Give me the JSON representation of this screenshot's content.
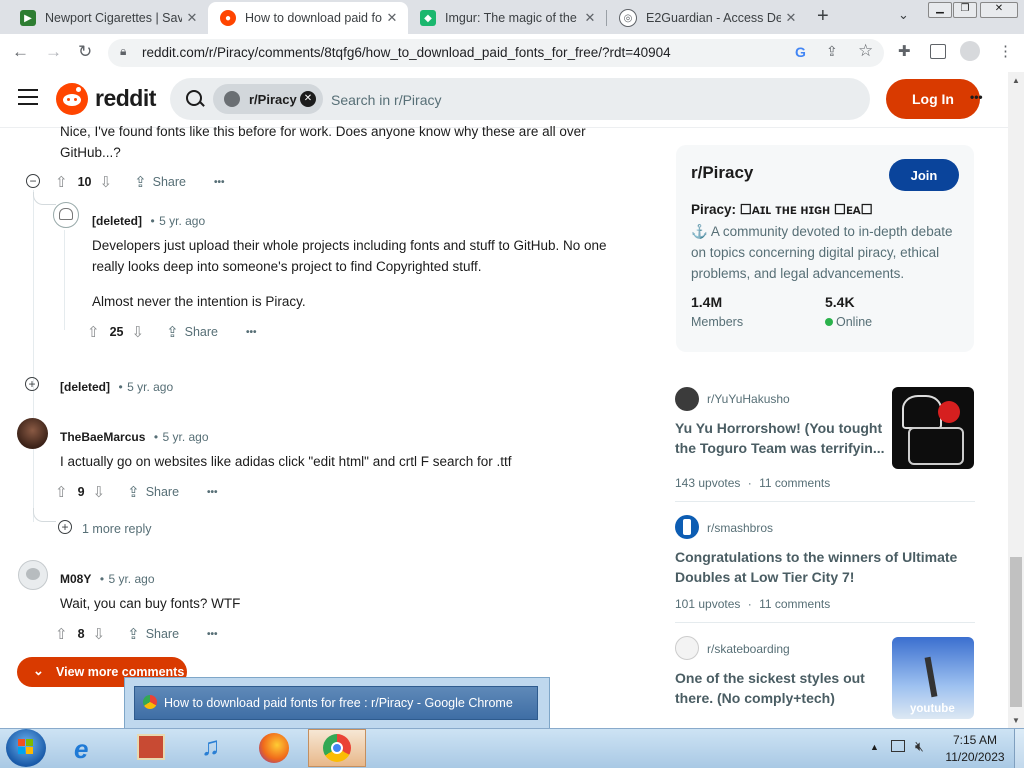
{
  "browser": {
    "tabs": [
      {
        "title": "Newport Cigarettes | Sav",
        "color": "#2e7d32",
        "glyph": "▶"
      },
      {
        "title": "How to download paid fo",
        "color": "#ff4500",
        "glyph": "●"
      },
      {
        "title": "Imgur: The magic of the",
        "color": "#1bb76e",
        "glyph": "◆"
      },
      {
        "title": "E2Guardian - Access Den",
        "color": "#5f6368",
        "glyph": "◎"
      }
    ],
    "new_tab": "+",
    "url": "reddit.com/r/Piracy/comments/8tqfg6/how_to_download_paid_fonts_for_free/?rdt=40904"
  },
  "reddit": {
    "logo_text": "reddit",
    "search_chip": "r/Piracy",
    "search_placeholder": "Search in r/Piracy",
    "login": "Log In",
    "more": "•••"
  },
  "comments": {
    "c1": {
      "text": "Nice, I've found fonts like this before for work. Does anyone know why these are all over GitHub...?",
      "votes": "10",
      "share": "Share",
      "more": "•••"
    },
    "c2": {
      "user": "[deleted]",
      "time": "5 yr. ago",
      "p1": "Developers just upload their whole projects including fonts and stuff to GitHub. No one really looks deep into someone's project to find Copyrighted stuff.",
      "p2": "Almost never the intention is Piracy.",
      "votes": "25",
      "share": "Share",
      "more": "•••"
    },
    "c3": {
      "user": "[deleted]",
      "time": "5 yr. ago"
    },
    "c4": {
      "user": "TheBaeMarcus",
      "time": "5 yr. ago",
      "text": "I actually go on websites like adidas click \"edit html\" and crtl F search for .ttf",
      "votes": "9",
      "share": "Share",
      "more": "•••",
      "more_reply": "1 more reply"
    },
    "c5": {
      "user": "M08Y",
      "time": "5 yr. ago",
      "text": "Wait, you can buy fonts? WTF",
      "votes": "8",
      "share": "Share",
      "more": "•••"
    },
    "view_more": "View more comments"
  },
  "sidebar": {
    "sub_name": "r/Piracy",
    "join": "Join",
    "tagline": "Piracy: ☐ᴀɪʟ ᴛʜᴇ ʜɪɢʜ ☐ᴇᴀ☐",
    "description": "⚓ A community devoted to in-depth debate on topics concerning digital piracy, ethical problems, and legal advancements.",
    "members_value": "1.4M",
    "members_label": "Members",
    "online_value": "5.4K",
    "online_label": "Online",
    "online_color": "#2bb24c",
    "posts": [
      {
        "sub": "r/YuYuHakusho",
        "title": "Yu Yu Horrorshow! (You tought the Toguro Team was terrifyin...",
        "upvotes": "143 upvotes",
        "comments": "11 comments"
      },
      {
        "sub": "r/smashbros",
        "title": "Congratulations to the winners of Ultimate Doubles at Low Tier City 7!",
        "upvotes": "101 upvotes",
        "comments": "11 comments"
      },
      {
        "sub": "r/skateboarding",
        "title": "One of the sickest styles out there. (No comply+tech)",
        "thumb_label": "youtube"
      }
    ]
  },
  "taskbar": {
    "preview_title": "How to download paid fonts for free : r/Piracy - Google Chrome",
    "time": "7:15 AM",
    "date": "11/20/2023"
  }
}
